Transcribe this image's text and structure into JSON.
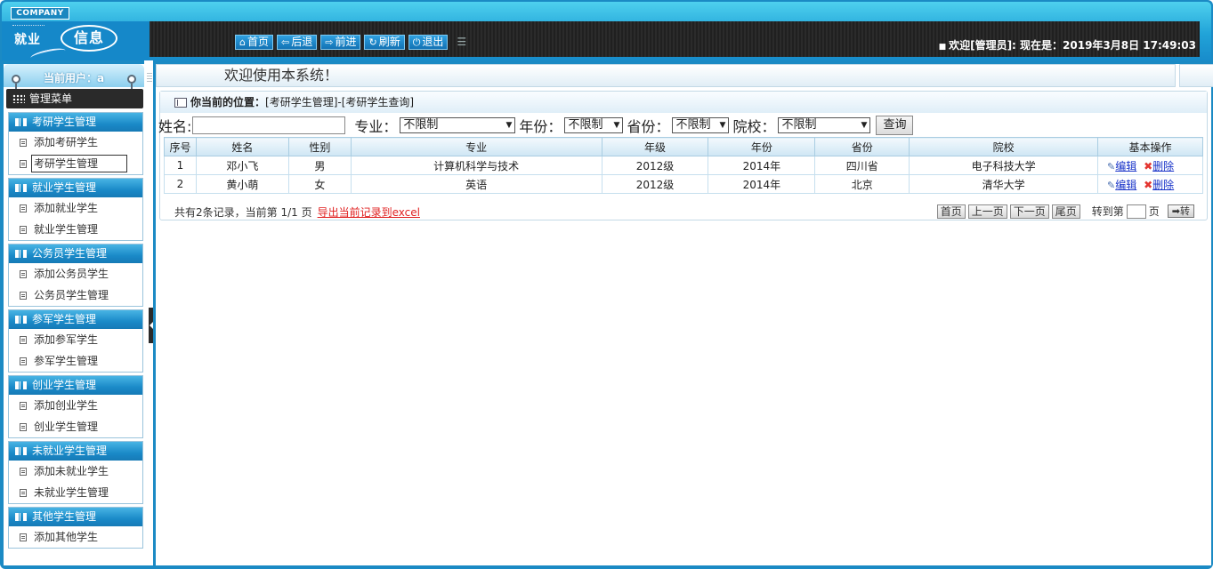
{
  "header": {
    "company": "COMPANY",
    "logo_small": "就业",
    "logo_big": "信息",
    "nav": [
      {
        "icon": "⌂",
        "label": "首页"
      },
      {
        "icon": "⇦",
        "label": "后退"
      },
      {
        "icon": "⇨",
        "label": "前进"
      },
      {
        "icon": "↻",
        "label": "刷新"
      },
      {
        "icon": "⏻",
        "label": "退出"
      }
    ],
    "welcome": "欢迎[管理员]:  现在是：2019年3月8日 17:49:03"
  },
  "sidebar": {
    "current_user": "当前用户：a",
    "menu_title": "管理菜单",
    "groups": [
      {
        "title": "考研学生管理",
        "items": [
          "添加考研学生",
          "考研学生管理"
        ]
      },
      {
        "title": "就业学生管理",
        "items": [
          "添加就业学生",
          "就业学生管理"
        ]
      },
      {
        "title": "公务员学生管理",
        "items": [
          "添加公务员学生",
          "公务员学生管理"
        ]
      },
      {
        "title": "参军学生管理",
        "items": [
          "添加参军学生",
          "参军学生管理"
        ]
      },
      {
        "title": "创业学生管理",
        "items": [
          "添加创业学生",
          "创业学生管理"
        ]
      },
      {
        "title": "未就业学生管理",
        "items": [
          "添加未就业学生",
          "未就业学生管理"
        ]
      },
      {
        "title": "其他学生管理",
        "items": [
          "添加其他学生"
        ]
      }
    ]
  },
  "main": {
    "welcome": "欢迎使用本系统！",
    "breadcrumb_label": "你当前的位置：",
    "breadcrumb_path": "[考研学生管理]-[考研学生查询]",
    "filter": {
      "name_label": "姓名:",
      "name_value": "",
      "major_label": "专业：",
      "major_value": "不限制",
      "year_label": "年份：",
      "year_value": "不限制",
      "province_label": "省份：",
      "province_value": "不限制",
      "school_label": "院校：",
      "school_value": "不限制",
      "query_label": "查询"
    },
    "table": {
      "headers": [
        "序号",
        "姓名",
        "性别",
        "专业",
        "年级",
        "年份",
        "省份",
        "院校",
        "基本操作"
      ],
      "rows": [
        [
          "1",
          "邓小飞",
          "男",
          "计算机科学与技术",
          "2012级",
          "2014年",
          "四川省",
          "电子科技大学"
        ],
        [
          "2",
          "黄小萌",
          "女",
          "英语",
          "2012级",
          "2014年",
          "北京",
          "清华大学"
        ]
      ],
      "edit_label": "编辑",
      "delete_label": "删除"
    },
    "pager": {
      "info": "共有2条记录，当前第 1/1 页",
      "export": "导出当前记录到excel",
      "first": "首页",
      "prev": "上一页",
      "next": "下一页",
      "last": "尾页",
      "goto_label": "转到第",
      "page_unit": "页",
      "go": "➡转"
    }
  }
}
